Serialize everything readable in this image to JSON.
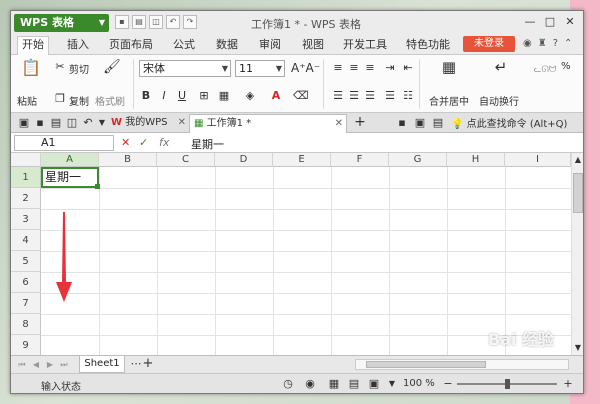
{
  "app": {
    "title": "WPS 表格",
    "window_title": "工作簿1 * - WPS 表格"
  },
  "menu": {
    "items": [
      "开始",
      "插入",
      "页面布局",
      "公式",
      "数据",
      "审阅",
      "视图",
      "开发工具",
      "特色功能"
    ],
    "login": "未登录"
  },
  "ribbon": {
    "paste": "粘贴",
    "cut": "剪切",
    "copy": "复制",
    "format_painter": "格式刷",
    "font_name": "宋体",
    "font_size": "11",
    "merge_center": "合并居中",
    "auto_wrap": "自动换行",
    "bold": "B",
    "italic": "I",
    "underline": "U",
    "percent": "%"
  },
  "tabs": {
    "my_wps": "我的WPS",
    "workbook": "工作簿1 *",
    "new_tab": "+",
    "find_command": "点此查找命令 (Alt+Q)"
  },
  "formula": {
    "name_box": "A1",
    "fx": "fx",
    "content": "星期一"
  },
  "grid": {
    "columns": [
      "A",
      "B",
      "C",
      "D",
      "E",
      "F",
      "G",
      "H",
      "I"
    ],
    "rows": [
      "1",
      "2",
      "3",
      "4",
      "5",
      "6",
      "7",
      "8",
      "9"
    ],
    "cell_a1": "星期一"
  },
  "sheets": {
    "tab": "Sheet1"
  },
  "status": {
    "mode": "输入状态",
    "zoom": "100 %"
  },
  "watermark": "Bai 经验",
  "colors": {
    "brand": "#3a8a2c",
    "accent": "#e8543a",
    "arrow": "#e8323a"
  }
}
